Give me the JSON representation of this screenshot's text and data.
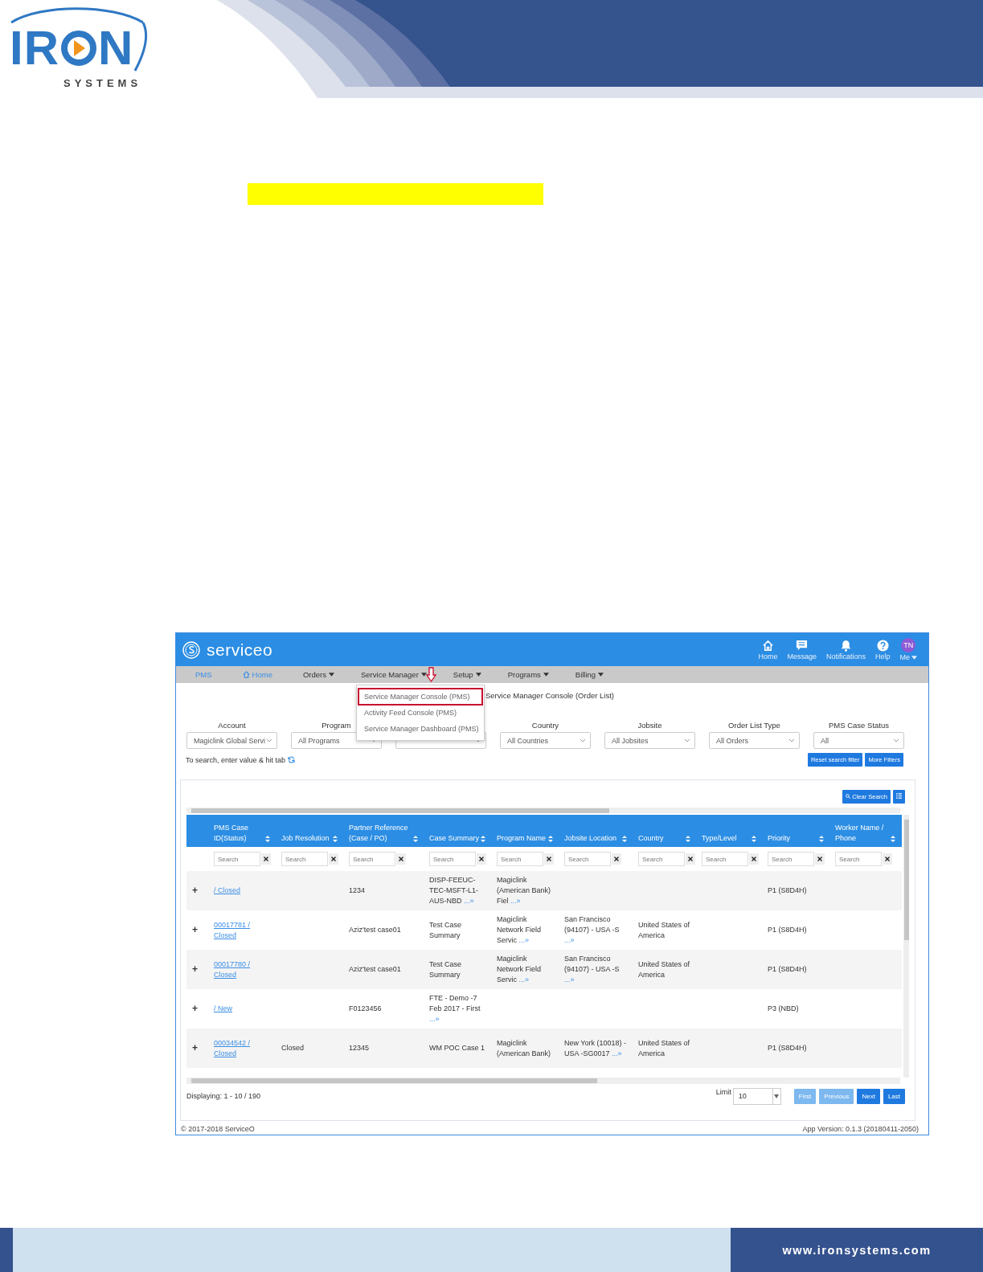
{
  "logo": {
    "name_start": "IR",
    "name_end": "N",
    "tagline": "SYSTEMS"
  },
  "app": {
    "brand": "serviceo",
    "top_icons": [
      {
        "kind": "home",
        "label": "Home"
      },
      {
        "kind": "message",
        "label": "Message"
      },
      {
        "kind": "bell",
        "label": "Notifications"
      },
      {
        "kind": "help",
        "label": "Help"
      }
    ],
    "user": {
      "initials": "TN",
      "label": "Me"
    },
    "nav": [
      {
        "kind": "link",
        "label": "PMS"
      },
      {
        "kind": "home",
        "label": "Home"
      },
      {
        "kind": "menu",
        "label": "Orders"
      },
      {
        "kind": "menu",
        "label": "Service Manager"
      },
      {
        "kind": "menu",
        "label": "Setup"
      },
      {
        "kind": "menu",
        "label": "Programs"
      },
      {
        "kind": "menu",
        "label": "Billing"
      }
    ],
    "menu": [
      {
        "label": "Service Manager Console (PMS)",
        "highlighted": true
      },
      {
        "label": "Activity Feed Console (PMS)",
        "highlighted": false
      },
      {
        "label": "Service Manager Dashboard (PMS)",
        "highlighted": false
      }
    ],
    "page_title": "Service Manager Console (Order List)",
    "filters": [
      {
        "kind": "dropdown",
        "label": "Account",
        "value": "Magiclink Global Servi"
      },
      {
        "kind": "dropdown",
        "label": "Program",
        "value": "All Programs"
      },
      {
        "kind": "covered"
      },
      {
        "kind": "dropdown",
        "label": "Country",
        "value": "All Countries"
      },
      {
        "kind": "dropdown",
        "label": "Jobsite",
        "value": "All Jobsites"
      },
      {
        "kind": "dropdown",
        "label": "Order List Type",
        "value": "All Orders"
      },
      {
        "kind": "dropdown",
        "label": "PMS Case Status",
        "value": "All"
      }
    ],
    "hint": "To search, enter value & hit tab",
    "filter_buttons": [
      "Reset search filter",
      "More Filters"
    ],
    "table": {
      "clear_search": "Clear Search",
      "columns": [
        {
          "label": "PMS Case ID(Status)",
          "sortable": true,
          "placeholder": "Search"
        },
        {
          "label": "Job Resolution",
          "sortable": true,
          "placeholder": "Search"
        },
        {
          "label": "Partner Reference (Case / PO)",
          "sortable": true,
          "placeholder": "Search"
        },
        {
          "label": "Case Summary",
          "sortable": true,
          "placeholder": "Search"
        },
        {
          "label": "Program Name",
          "sortable": true,
          "placeholder": "Search"
        },
        {
          "label": "Jobsite Location",
          "sortable": true,
          "placeholder": "Search"
        },
        {
          "label": "Country",
          "sortable": true,
          "placeholder": "Search"
        },
        {
          "label": "Type/Level",
          "sortable": true,
          "placeholder": "Search"
        },
        {
          "label": "Priority",
          "sortable": true,
          "placeholder": "Search"
        },
        {
          "label": "Worker Name / Phone",
          "sortable": true,
          "placeholder": "Search"
        }
      ],
      "rows": [
        {
          "expand": "+",
          "case_id": "/ Closed",
          "partner_reference": "1234",
          "case_summary": {
            "text": "DISP-FEEUC-TEC-MSFT-L1-AUS-NBD",
            "more": "...»"
          },
          "program_name": {
            "text": "Magiclink (American Bank) Fiel",
            "more": "...»"
          },
          "priority": "P1 (S8D4H)"
        },
        {
          "expand": "+",
          "case_id": "00017781 / Closed",
          "partner_reference": "Aziz'test case01",
          "case_summary": {
            "text": "Test Case Summary"
          },
          "program_name": {
            "text": "Magiclink Network Field Servic",
            "more": "...»"
          },
          "jobsite_location": {
            "text": "San Francisco (94107) - USA -S",
            "more": "...»"
          },
          "country": "United States of America",
          "priority": "P1 (S8D4H)"
        },
        {
          "expand": "+",
          "case_id": "00017780 / Closed",
          "partner_reference": "Aziz'test case01",
          "case_summary": {
            "text": "Test Case Summary"
          },
          "program_name": {
            "text": "Magiclink Network Field Servic",
            "more": "...»"
          },
          "jobsite_location": {
            "text": "San Francisco (94107) - USA -S",
            "more": "...»"
          },
          "country": "United States of America",
          "priority": "P1 (S8D4H)"
        },
        {
          "expand": "+",
          "case_id": "/ New",
          "partner_reference": "F0123456",
          "case_summary": {
            "text": "FTE - Demo -7 Feb 2017 - First",
            "more": "...»"
          },
          "priority": "P3 (NBD)"
        },
        {
          "expand": "+",
          "case_id": "00034542 / Closed",
          "job_resolution": "Closed",
          "partner_reference": "12345",
          "case_summary": {
            "text": "WM POC Case 1"
          },
          "program_name": {
            "text": "Magiclink (American Bank)"
          },
          "jobsite_location": {
            "text": "New York (10018) - USA -SG0017",
            "more": "...»"
          },
          "country": "United States of America",
          "priority": "P1 (S8D4H)"
        }
      ]
    },
    "pager": {
      "displaying": "Displaying: 1 - 10 / 190",
      "limit_label": "Limit",
      "limit": "10",
      "buttons": [
        {
          "label": "First",
          "disabled": true
        },
        {
          "label": "Previous",
          "disabled": true
        },
        {
          "label": "Next",
          "disabled": false
        },
        {
          "label": "Last",
          "disabled": false
        }
      ]
    },
    "copyright": "© 2017-2018 ServiceO",
    "version": "App Version: 0.1.3 (20180411-2050)"
  },
  "footer": {
    "website": "www.ironsystems.com"
  }
}
